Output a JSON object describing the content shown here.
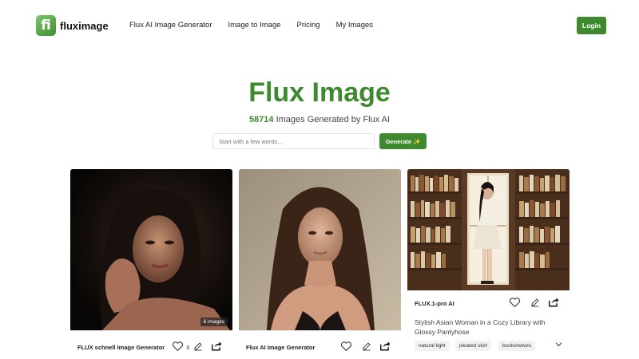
{
  "nav": {
    "logo_text": "fluximage",
    "logo_mark": "fi",
    "links": [
      "Flux AI Image Generator",
      "Image to Image",
      "Pricing",
      "My Images"
    ],
    "login": "Login"
  },
  "hero": {
    "title": "Flux Image",
    "count": "58714",
    "subtitle_rest": " Images Generated by Flux AI"
  },
  "search": {
    "placeholder": "Start with a few words...",
    "value": "",
    "button": "Generate ✨"
  },
  "cards": [
    {
      "title": "FLUX schnell Image Generator",
      "likes": "3",
      "badge": "6 images",
      "image": "portrait-woman-dark-background"
    },
    {
      "title": "Flux AI Image Generator",
      "likes": "",
      "image": "portrait-woman-long-hair"
    },
    {
      "title": "FLUX.1-pro AI",
      "prompt": "Stylish Asian Woman in a Cozy Library with Glossy Pantyhose",
      "tags": [
        "natural light",
        "pleated skirt",
        "bookshelves"
      ],
      "image": "woman-in-library"
    }
  ],
  "colors": {
    "accent": "#3f8a2e"
  },
  "icons": [
    "heart-icon",
    "edit-icon",
    "share-icon",
    "chevron-down-icon"
  ]
}
